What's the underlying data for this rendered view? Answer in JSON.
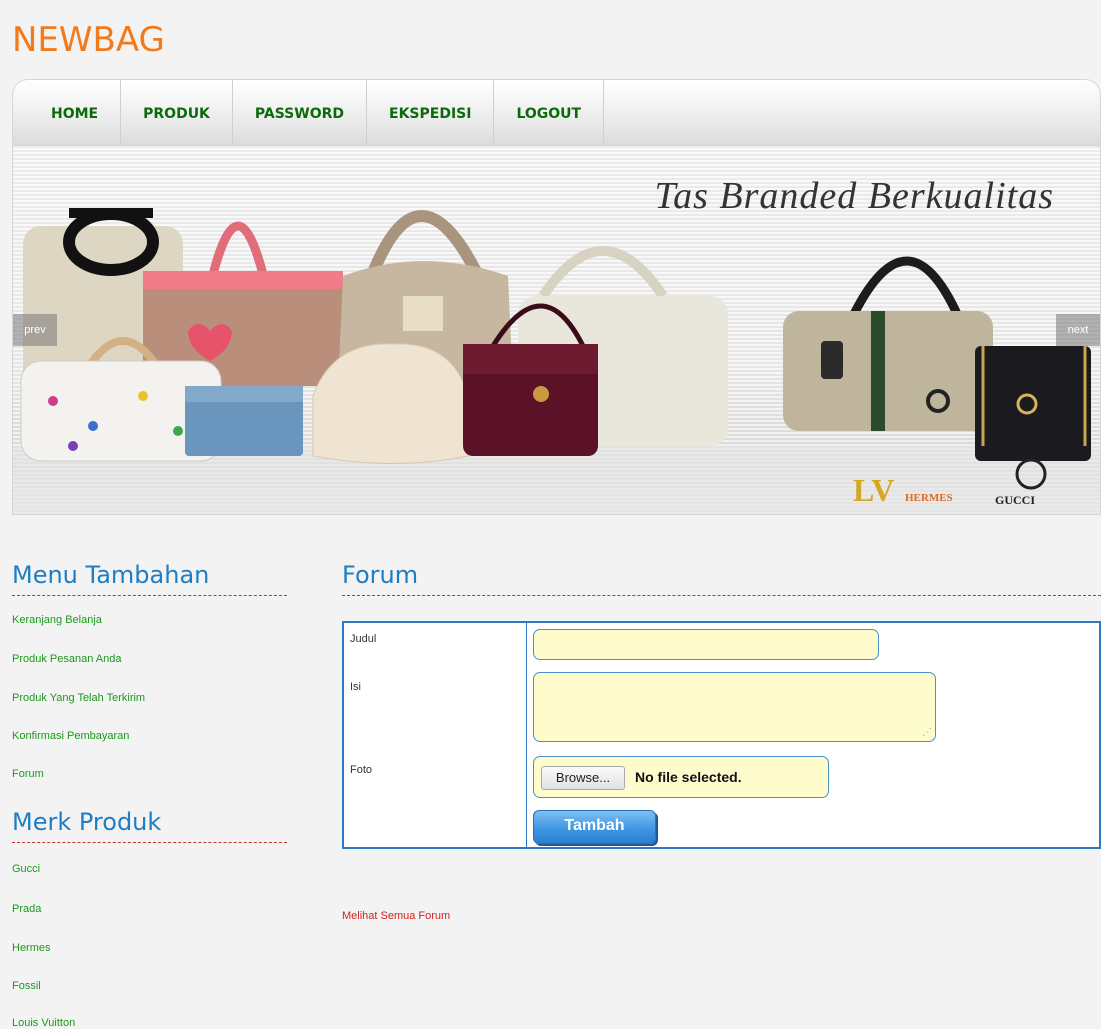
{
  "logo": "NEWBAG",
  "nav": {
    "items": [
      {
        "label": "HOME"
      },
      {
        "label": "PRODUK"
      },
      {
        "label": "PASSWORD"
      },
      {
        "label": "EKSPEDISI"
      },
      {
        "label": "LOGOUT"
      }
    ]
  },
  "banner": {
    "title": "Tas Branded Berkualitas",
    "prev_label": "prev",
    "next_label": "next",
    "brand_marks": [
      "HERMES",
      "GUCCI"
    ]
  },
  "sidebar": {
    "menu_heading": "Menu Tambahan",
    "menu_links": [
      {
        "label": "Keranjang Belanja"
      },
      {
        "label": "Produk Pesanan Anda"
      },
      {
        "label": "Produk Yang Telah Terkirim"
      },
      {
        "label": "Konfirmasi Pembayaran"
      },
      {
        "label": "Forum"
      }
    ],
    "brand_heading": "Merk Produk",
    "brand_links": [
      {
        "label": "Gucci"
      },
      {
        "label": "Prada"
      },
      {
        "label": "Hermes"
      },
      {
        "label": "Fossil"
      },
      {
        "label": "Louis Vuitton"
      }
    ]
  },
  "forum": {
    "heading": "Forum",
    "fields": {
      "judul_label": "Judul",
      "judul_value": "",
      "isi_label": "Isi",
      "isi_value": "",
      "foto_label": "Foto",
      "browse_label": "Browse...",
      "file_status": "No file selected."
    },
    "submit_label": "Tambah",
    "view_all_label": "Melihat Semua Forum"
  },
  "colors": {
    "logo": "#f07a1c",
    "nav_text": "#0b6b0b",
    "heading": "#1e7ec1",
    "link": "#1a9a1a",
    "form_border": "#2f79bf",
    "input_bg": "#fefccc",
    "view_all": "#d42020"
  }
}
